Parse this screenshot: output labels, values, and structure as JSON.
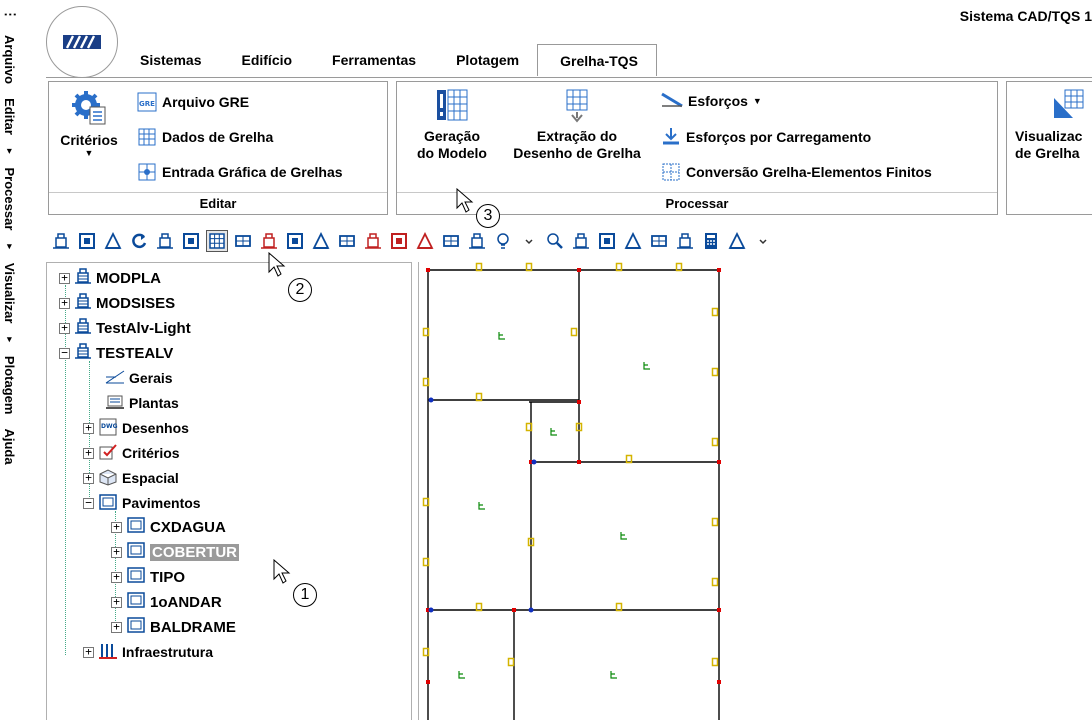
{
  "app": {
    "title": "Sistema CAD/TQS 1"
  },
  "vertical_menu": [
    {
      "label": "Arquivo",
      "arrow": ""
    },
    {
      "label": "Editar",
      "arrow": "▸"
    },
    {
      "label": "Processar",
      "arrow": "▸"
    },
    {
      "label": "Visualizar",
      "arrow": "▸"
    },
    {
      "label": "Plotagem",
      "arrow": ""
    },
    {
      "label": "Ajuda",
      "arrow": ""
    }
  ],
  "vertical_menu_overflow": "⋮",
  "tabs": [
    "Sistemas",
    "Edifício",
    "Ferramentas",
    "Plotagem",
    "Grelha-TQS"
  ],
  "active_tab": "Grelha-TQS",
  "ribbon": {
    "editar": {
      "title": "Editar",
      "criterios": "Critérios",
      "arquivo_gre": "Arquivo GRE",
      "dados_grelha": "Dados de Grelha",
      "entrada_grafica": "Entrada Gráfica de Grelhas"
    },
    "processar": {
      "title": "Processar",
      "geracao_line1": "Geração",
      "geracao_line2": "do Modelo",
      "extracao_line1": "Extração do",
      "extracao_line2": "Desenho de Grelha",
      "esforcos": "Esforços",
      "esforcos_carregamento": "Esforços por Carregamento",
      "conversao": "Conversão Grelha-Elementos Finitos"
    },
    "visualizar": {
      "line1": "Visualizac",
      "line2": "de Grelha"
    }
  },
  "tree": {
    "roots": [
      "MODPLA",
      "MODSISES",
      "TestAlv-Light",
      "TESTEALV"
    ],
    "testealv_children": [
      "Gerais",
      "Plantas",
      "Desenhos",
      "Critérios",
      "Espacial",
      "Pavimentos"
    ],
    "pavimentos": [
      "CXDAGUA",
      "COBERTUR",
      "TIPO",
      "1oANDAR",
      "BALDRAME"
    ],
    "infra": "Infraestrutura",
    "selected": "COBERTUR"
  },
  "callouts": [
    "1",
    "2",
    "3"
  ],
  "colors": {
    "beam": "#000000",
    "support_yellow": "#d4b400",
    "label_green": "#0a8a0a",
    "node_red": "#e00000",
    "node_blue": "#1030c0",
    "selected_bg": "#9a9a9a"
  }
}
